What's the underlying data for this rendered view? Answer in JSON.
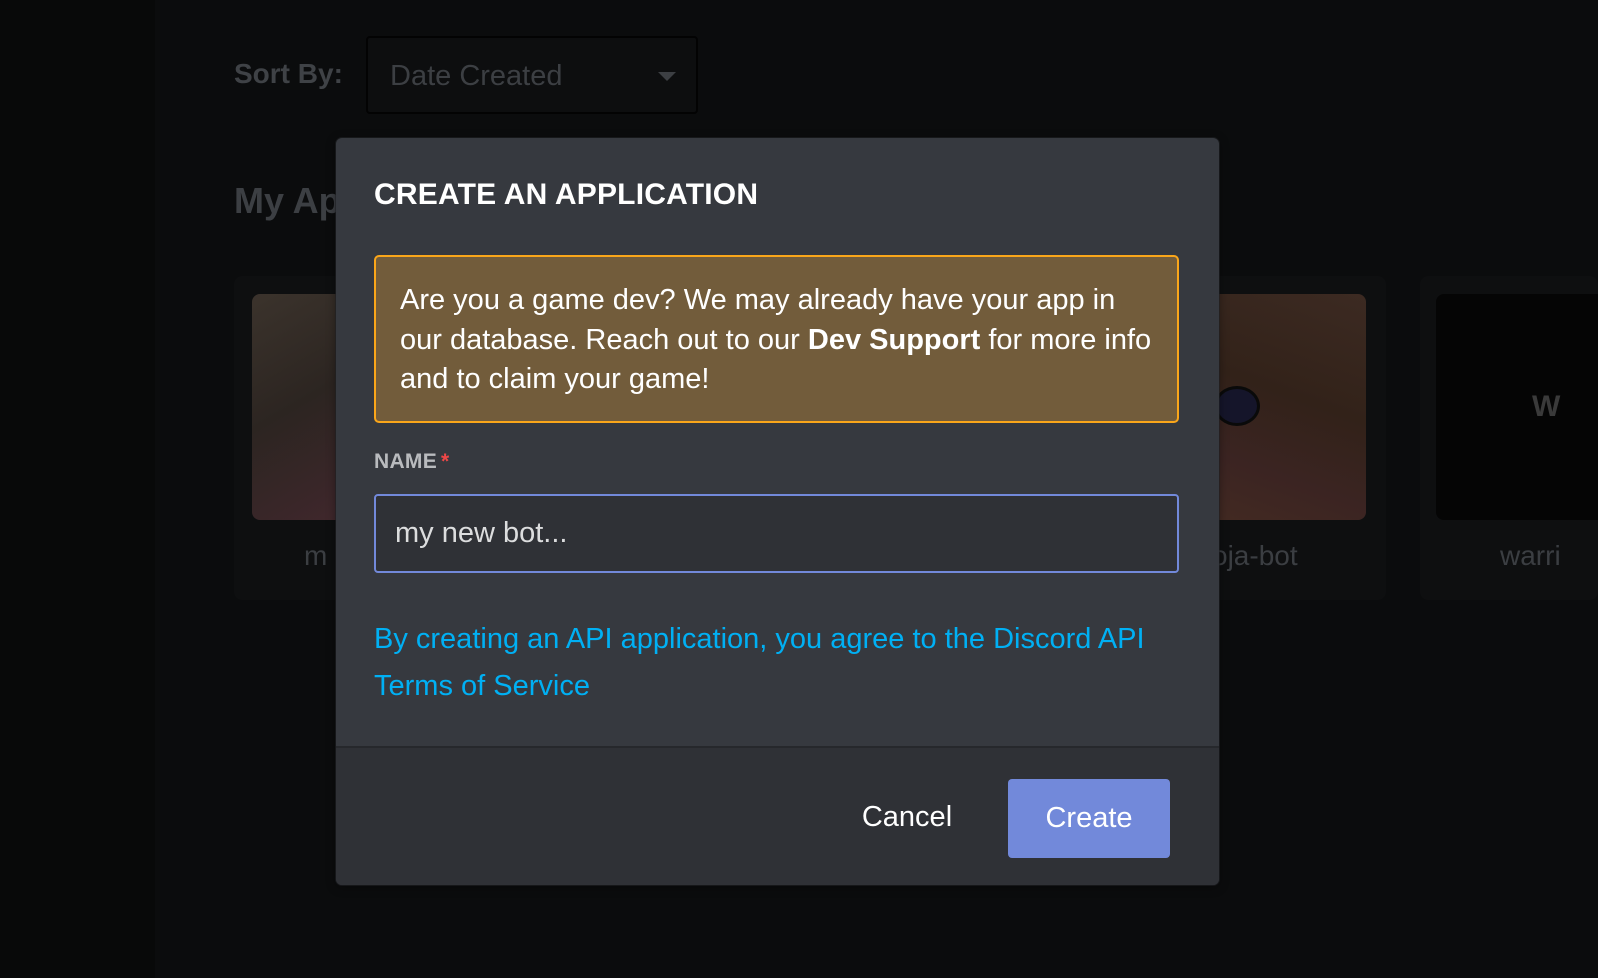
{
  "background": {
    "sort": {
      "label": "Sort By:",
      "selected": "Date Created"
    },
    "section_title": "My Ap",
    "apps": [
      {
        "name": "m"
      },
      {
        "name": "oja-bot"
      },
      {
        "name": "warri",
        "thumb_letter": "W"
      }
    ]
  },
  "modal": {
    "title": "CREATE AN APPLICATION",
    "notice": {
      "before": "Are you a game dev? We may already have your app in our database. Reach out to our ",
      "bold": "Dev Support",
      "after": " for more info and to claim your game!"
    },
    "name_field": {
      "label": "NAME",
      "required_mark": "*",
      "value": "my new bot..."
    },
    "tos_link": "By creating an API application, you agree to the Discord API Terms of Service",
    "buttons": {
      "cancel": "Cancel",
      "create": "Create"
    }
  },
  "colors": {
    "modal_bg": "#36393f",
    "footer_bg": "#2f3136",
    "notice_bg": "#725c3b",
    "notice_border": "#faa61a",
    "accent": "#7289da",
    "link": "#00b0f4",
    "required": "#f04747"
  }
}
